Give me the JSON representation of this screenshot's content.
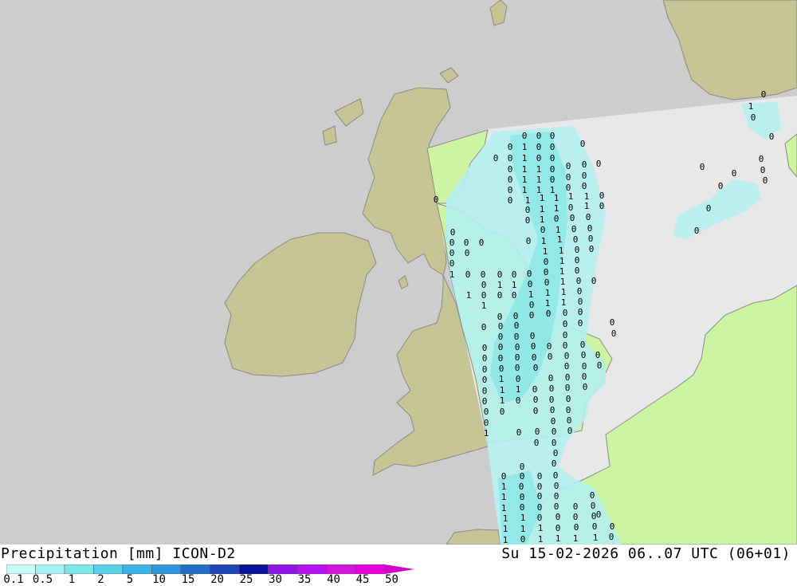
{
  "header": {
    "title_left": "Precipitation [mm] ICON-D2",
    "title_right": "Su 15-02-2026 06..07 UTC (06+01)"
  },
  "colors": {
    "sea": "#cdcdcd",
    "land_outside": "#c5c595",
    "land_domain": "#ccf4a2",
    "sea_domain": "#e8e8e8",
    "coast": "#8a8a8a"
  },
  "legend": {
    "ticks": [
      "0.1",
      "0.5",
      "1",
      "2",
      "5",
      "10",
      "15",
      "20",
      "25",
      "30",
      "35",
      "40",
      "45",
      "50"
    ],
    "colors": [
      "#c8fafa",
      "#a6f2f2",
      "#80e6e6",
      "#5ad0e6",
      "#3cb4e6",
      "#3296dc",
      "#286ec8",
      "#1e46b4",
      "#0a1496",
      "#8c14e6",
      "#b414f0",
      "#d214dc",
      "#e600dc",
      "#d200c8"
    ]
  },
  "values": [
    [
      "0",
      658,
      170
    ],
    [
      "0",
      676,
      170
    ],
    [
      "0",
      693,
      170
    ],
    [
      "0",
      640,
      184
    ],
    [
      "1",
      658,
      184
    ],
    [
      "0",
      676,
      184
    ],
    [
      "0",
      693,
      184
    ],
    [
      "0",
      731,
      180
    ],
    [
      "0",
      622,
      198
    ],
    [
      "0",
      640,
      198
    ],
    [
      "1",
      658,
      198
    ],
    [
      "0",
      676,
      198
    ],
    [
      "0",
      693,
      198
    ],
    [
      "0",
      640,
      212
    ],
    [
      "1",
      658,
      212
    ],
    [
      "1",
      676,
      212
    ],
    [
      "0",
      693,
      212
    ],
    [
      "0",
      713,
      208
    ],
    [
      "0",
      733,
      206
    ],
    [
      "0",
      751,
      205
    ],
    [
      "0",
      640,
      225
    ],
    [
      "1",
      658,
      225
    ],
    [
      "1",
      676,
      225
    ],
    [
      "0",
      693,
      225
    ],
    [
      "0",
      713,
      222
    ],
    [
      "0",
      733,
      220
    ],
    [
      "0",
      640,
      238
    ],
    [
      "1",
      658,
      238
    ],
    [
      "1",
      676,
      238
    ],
    [
      "1",
      693,
      238
    ],
    [
      "0",
      713,
      235
    ],
    [
      "0",
      733,
      233
    ],
    [
      "0",
      640,
      251
    ],
    [
      "1",
      662,
      251
    ],
    [
      "1",
      680,
      248
    ],
    [
      "1",
      698,
      248
    ],
    [
      "1",
      716,
      246
    ],
    [
      "1",
      736,
      246
    ],
    [
      "0",
      755,
      245
    ],
    [
      "0",
      547,
      250
    ],
    [
      "0",
      662,
      263
    ],
    [
      "1",
      680,
      262
    ],
    [
      "1",
      698,
      261
    ],
    [
      "0",
      716,
      260
    ],
    [
      "1",
      736,
      258
    ],
    [
      "0",
      755,
      258
    ],
    [
      "0",
      662,
      276
    ],
    [
      "1",
      680,
      275
    ],
    [
      "0",
      698,
      274
    ],
    [
      "0",
      718,
      273
    ],
    [
      "0",
      738,
      272
    ],
    [
      "0",
      568,
      291
    ],
    [
      "0",
      681,
      288
    ],
    [
      "1",
      700,
      288
    ],
    [
      "0",
      720,
      287
    ],
    [
      "0",
      740,
      286
    ],
    [
      "0",
      567,
      304
    ],
    [
      "0",
      585,
      304
    ],
    [
      "0",
      604,
      304
    ],
    [
      "0",
      663,
      302
    ],
    [
      "1",
      682,
      302
    ],
    [
      "1",
      702,
      300
    ],
    [
      "0",
      722,
      300
    ],
    [
      "0",
      741,
      299
    ],
    [
      "0",
      567,
      317
    ],
    [
      "0",
      586,
      317
    ],
    [
      "1",
      684,
      315
    ],
    [
      "1",
      704,
      314
    ],
    [
      "0",
      724,
      313
    ],
    [
      "0",
      742,
      312
    ],
    [
      "0",
      567,
      330
    ],
    [
      "0",
      685,
      328
    ],
    [
      "1",
      705,
      327
    ],
    [
      "0",
      724,
      326
    ],
    [
      "1",
      567,
      344
    ],
    [
      "0",
      587,
      344
    ],
    [
      "0",
      606,
      344
    ],
    [
      "0",
      627,
      344
    ],
    [
      "0",
      645,
      344
    ],
    [
      "0",
      664,
      343
    ],
    [
      "0",
      685,
      341
    ],
    [
      "1",
      705,
      340
    ],
    [
      "0",
      724,
      339
    ],
    [
      "0",
      607,
      357
    ],
    [
      "1",
      627,
      357
    ],
    [
      "1",
      645,
      357
    ],
    [
      "0",
      665,
      356
    ],
    [
      "0",
      686,
      354
    ],
    [
      "1",
      706,
      353
    ],
    [
      "0",
      726,
      352
    ],
    [
      "0",
      745,
      352
    ],
    [
      "1",
      588,
      370
    ],
    [
      "0",
      607,
      370
    ],
    [
      "0",
      627,
      370
    ],
    [
      "0",
      645,
      370
    ],
    [
      "1",
      666,
      369
    ],
    [
      "1",
      687,
      367
    ],
    [
      "1",
      707,
      366
    ],
    [
      "0",
      727,
      365
    ],
    [
      "1",
      607,
      383
    ],
    [
      "0",
      667,
      382
    ],
    [
      "1",
      687,
      380
    ],
    [
      "1",
      707,
      379
    ],
    [
      "0",
      728,
      378
    ],
    [
      "0",
      627,
      397
    ],
    [
      "0",
      647,
      396
    ],
    [
      "0",
      667,
      395
    ],
    [
      "0",
      688,
      393
    ],
    [
      "0",
      709,
      392
    ],
    [
      "0",
      728,
      391
    ],
    [
      "0",
      607,
      410
    ],
    [
      "0",
      628,
      409
    ],
    [
      "0",
      648,
      408
    ],
    [
      "0",
      709,
      406
    ],
    [
      "0",
      728,
      405
    ],
    [
      "0",
      768,
      404
    ],
    [
      "0",
      770,
      418
    ],
    [
      "0",
      628,
      422
    ],
    [
      "0",
      648,
      422
    ],
    [
      "0",
      668,
      421
    ],
    [
      "0",
      709,
      420
    ],
    [
      "0",
      608,
      436
    ],
    [
      "0",
      628,
      435
    ],
    [
      "0",
      649,
      435
    ],
    [
      "0",
      669,
      434
    ],
    [
      "0",
      689,
      434
    ],
    [
      "0",
      709,
      433
    ],
    [
      "0",
      731,
      432
    ],
    [
      "0",
      608,
      449
    ],
    [
      "0",
      628,
      449
    ],
    [
      "0",
      649,
      448
    ],
    [
      "0",
      670,
      448
    ],
    [
      "0",
      690,
      447
    ],
    [
      "0",
      711,
      446
    ],
    [
      "0",
      732,
      445
    ],
    [
      "0",
      750,
      445
    ],
    [
      "0",
      608,
      463
    ],
    [
      "0",
      629,
      462
    ],
    [
      "0",
      649,
      461
    ],
    [
      "0",
      672,
      461
    ],
    [
      "0",
      711,
      459
    ],
    [
      "0",
      733,
      459
    ],
    [
      "0",
      752,
      458
    ],
    [
      "0",
      608,
      476
    ],
    [
      "1",
      629,
      475
    ],
    [
      "0",
      650,
      475
    ],
    [
      "0",
      691,
      474
    ],
    [
      "0",
      712,
      473
    ],
    [
      "0",
      733,
      472
    ],
    [
      "0",
      608,
      490
    ],
    [
      "1",
      630,
      489
    ],
    [
      "1",
      650,
      488
    ],
    [
      "0",
      671,
      488
    ],
    [
      "0",
      692,
      487
    ],
    [
      "0",
      712,
      486
    ],
    [
      "0",
      734,
      485
    ],
    [
      "0",
      608,
      503
    ],
    [
      "1",
      630,
      502
    ],
    [
      "0",
      650,
      502
    ],
    [
      "0",
      672,
      501
    ],
    [
      "0",
      692,
      501
    ],
    [
      "0",
      713,
      500
    ],
    [
      "0",
      610,
      516
    ],
    [
      "0",
      630,
      516
    ],
    [
      "0",
      672,
      515
    ],
    [
      "0",
      693,
      514
    ],
    [
      "0",
      713,
      514
    ],
    [
      "0",
      610,
      530
    ],
    [
      "0",
      694,
      528
    ],
    [
      "0",
      714,
      527
    ],
    [
      "1",
      610,
      543
    ],
    [
      "0",
      651,
      542
    ],
    [
      "0",
      674,
      541
    ],
    [
      "0",
      695,
      541
    ],
    [
      "0",
      715,
      540
    ],
    [
      "0",
      673,
      555
    ],
    [
      "0",
      695,
      555
    ],
    [
      "0",
      697,
      568
    ],
    [
      "0",
      695,
      581
    ],
    [
      "0",
      655,
      585
    ],
    [
      "0",
      632,
      597
    ],
    [
      "0",
      655,
      597
    ],
    [
      "0",
      677,
      597
    ],
    [
      "0",
      697,
      596
    ],
    [
      "1",
      632,
      610
    ],
    [
      "0",
      654,
      610
    ],
    [
      "0",
      677,
      610
    ],
    [
      "0",
      698,
      609
    ],
    [
      "1",
      632,
      623
    ],
    [
      "0",
      655,
      623
    ],
    [
      "0",
      677,
      622
    ],
    [
      "0",
      698,
      622
    ],
    [
      "0",
      743,
      621
    ],
    [
      "1",
      632,
      637
    ],
    [
      "0",
      655,
      636
    ],
    [
      "0",
      677,
      636
    ],
    [
      "0",
      698,
      635
    ],
    [
      "0",
      722,
      635
    ],
    [
      "0",
      744,
      634
    ],
    [
      "1",
      634,
      650
    ],
    [
      "1",
      656,
      649
    ],
    [
      "0",
      677,
      649
    ],
    [
      "0",
      700,
      648
    ],
    [
      "0",
      722,
      648
    ],
    [
      "0",
      745,
      647
    ],
    [
      "0",
      751,
      645
    ],
    [
      "1",
      634,
      663
    ],
    [
      "1",
      656,
      663
    ],
    [
      "1",
      678,
      662
    ],
    [
      "0",
      700,
      662
    ],
    [
      "0",
      723,
      661
    ],
    [
      "0",
      746,
      660
    ],
    [
      "0",
      768,
      660
    ],
    [
      "1",
      634,
      677
    ],
    [
      "0",
      656,
      676
    ],
    [
      "1",
      678,
      676
    ],
    [
      "1",
      700,
      675
    ],
    [
      "1",
      722,
      675
    ],
    [
      "1",
      747,
      674
    ],
    [
      "0",
      767,
      673
    ],
    [
      "0",
      958,
      118
    ],
    [
      "1",
      942,
      133
    ],
    [
      "0",
      945,
      147
    ],
    [
      "0",
      968,
      171
    ],
    [
      "0",
      955,
      199
    ],
    [
      "0",
      957,
      213
    ],
    [
      "0",
      960,
      226
    ],
    [
      "0",
      921,
      217
    ],
    [
      "0",
      904,
      233
    ],
    [
      "0",
      881,
      209
    ],
    [
      "0",
      889,
      261
    ],
    [
      "0",
      874,
      289
    ]
  ]
}
